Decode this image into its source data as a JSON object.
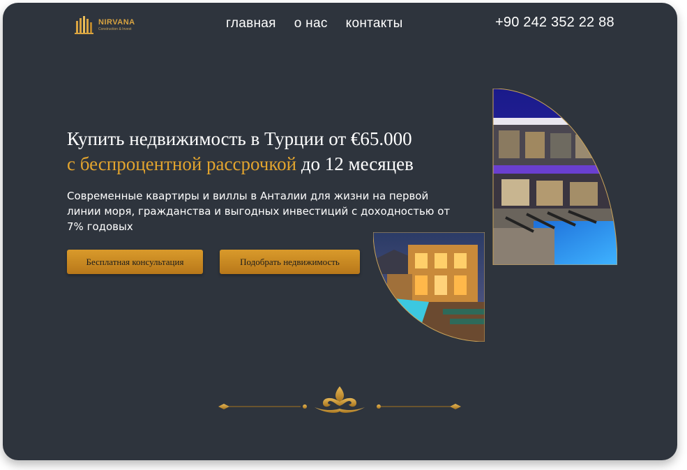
{
  "header": {
    "logo": {
      "name": "NIRVANA",
      "tagline": "Construction & Invest"
    },
    "nav": [
      "главная",
      "о нас",
      "контакты"
    ],
    "phone": "+90 242 352 22 88"
  },
  "hero": {
    "headline_line1": "Купить недвижимость в Турции от €65.000",
    "headline_accent": "с беспроцентной рассрочкой",
    "headline_rest": "до 12 месяцев",
    "subtext": "Современные квартиры и виллы в Анталии для жизни на первой линии моря, гражданства и выгодных инвестиций с доходностью от 7% годовых",
    "buttons": {
      "consult": "Бесплатная консультация",
      "select": "Подобрать недвижимость"
    }
  },
  "colors": {
    "background": "#2e343d",
    "accent": "#e2a42e",
    "button": "#d1912a",
    "text": "#ffffff"
  },
  "images": {
    "large": "modern-villa-pool-night-photo",
    "small": "mediterranean-villa-pool-evening-photo"
  },
  "icons": [
    "building-logo-icon",
    "ornament-divider-icon"
  ]
}
